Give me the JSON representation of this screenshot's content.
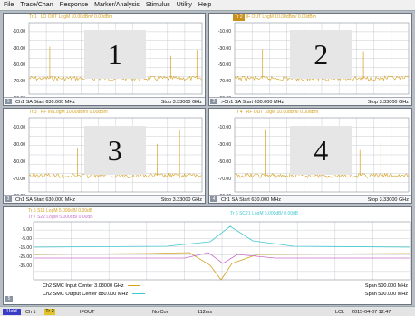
{
  "menu": [
    "File",
    "Trace/Chan",
    "Response",
    "Marker/Analysis",
    "Stimulus",
    "Utility",
    "Help"
  ],
  "y_ticks": [
    "-10.00",
    "-30.00",
    "-50.00",
    "-70.00",
    "-90.00"
  ],
  "bottom_y_ticks": [
    "5.00",
    "-5.00",
    "-15.00",
    "-25.00",
    "-35.00"
  ],
  "panels": [
    {
      "trace": "Tr 1",
      "header": "LO OUT LogM 10.00dBm/ 0.00dBm",
      "number": "1",
      "footer_num": "1",
      "footer_left": "Ch1 SA Start 630.000 MHz",
      "footer_right": "Stop 3.33000 GHz",
      "trace_color": "#d4a020"
    },
    {
      "trace": "Tr 2",
      "header": "IF OUT LogM 10.00dBm/ 0.00dBm",
      "number": "2",
      "footer_num": "2",
      "footer_left": ">Ch1 SA Start 630.000 MHz",
      "footer_right": "Stop 3.33000 GHz",
      "trace_color": "#d4a020"
    },
    {
      "trace": "Tr 3",
      "header": "RF IN LogM 10.00dBm/ 0.00dBm",
      "number": "3",
      "footer_num": "3",
      "footer_left": "Ch1 SA Start 630.000 MHz",
      "footer_right": "Stop 3.33000 GHz",
      "trace_color": "#d4a020"
    },
    {
      "trace": "Tr 4",
      "header": "RF OUT LogM 10.00dBm/ 0.00dBm",
      "number": "4",
      "footer_num": "4",
      "footer_left": "Ch1 SA Start 630.000 MHz",
      "footer_right": "Stop 3.33000 GHz",
      "trace_color": "#d4a020"
    }
  ],
  "bottom": {
    "tr5": "Tr 5 S11 LogM 5.000dB/ 0.00dB",
    "tr7": "Tr 7 S22 LogM 5.000dB/ 0.00dB",
    "tr6": "Tr 6 SC21 LogM 5.000dB/ 0.00dB",
    "line1": "Ch2 SMC Input Center 3.08000 GHz",
    "line1_right": "Span 500.000 MHz",
    "line2": "Ch2 SMC Output Center 880.000 MHz",
    "line2_right": "Span 500.000 MHz",
    "num": "5",
    "tr5_color": "#d4a020",
    "tr6_color": "#40c8d0",
    "tr7_color": "#c870c8"
  },
  "status": {
    "hold": "Hold",
    "ch": "Ch 1",
    "tr": "Tr 2",
    "ifout": "IFOUT",
    "nocor": "No Cor",
    "time": "112ms",
    "lcl": "LCL",
    "datetime": "2015-04-07 12:47"
  }
}
